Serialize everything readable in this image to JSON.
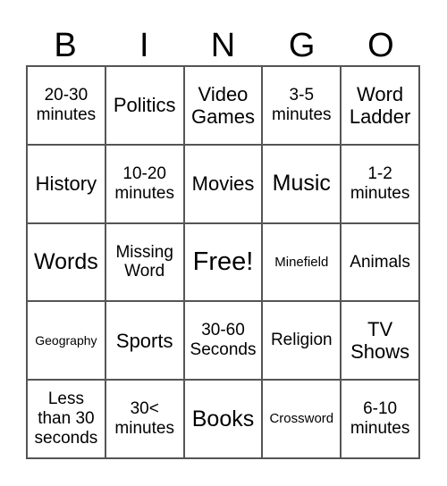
{
  "header": [
    "B",
    "I",
    "N",
    "G",
    "O"
  ],
  "cells": [
    [
      "20-30 minutes",
      "Politics",
      "Video Games",
      "3-5 minutes",
      "Word Ladder"
    ],
    [
      "History",
      "10-20 minutes",
      "Movies",
      "Music",
      "1-2 minutes"
    ],
    [
      "Words",
      "Missing Word",
      "Free!",
      "Minefield",
      "Animals"
    ],
    [
      "Geography",
      "Sports",
      "30-60 Seconds",
      "Religion",
      "TV Shows"
    ],
    [
      "Less than 30 seconds",
      "30< minutes",
      "Books",
      "Crossword",
      "6-10 minutes"
    ]
  ]
}
